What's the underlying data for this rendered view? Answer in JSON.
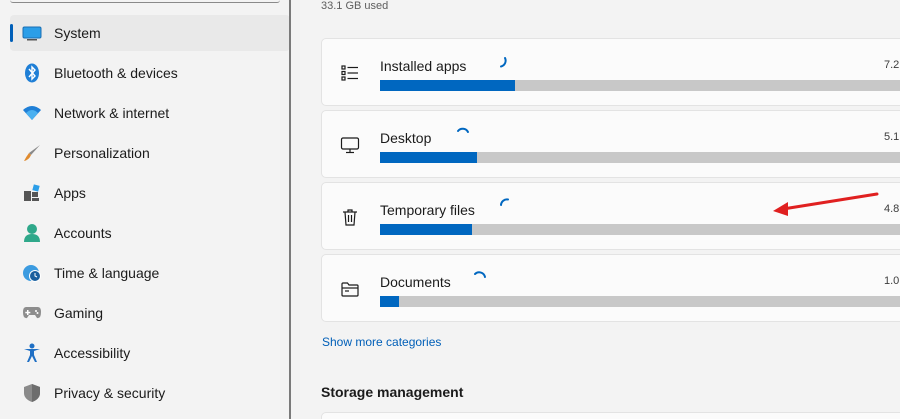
{
  "sidebar": {
    "items": [
      {
        "label": "System",
        "icon": "monitor-icon",
        "selected": true
      },
      {
        "label": "Bluetooth & devices",
        "icon": "bluetooth-icon"
      },
      {
        "label": "Network & internet",
        "icon": "wifi-icon"
      },
      {
        "label": "Personalization",
        "icon": "paintbrush-icon"
      },
      {
        "label": "Apps",
        "icon": "apps-grid-icon"
      },
      {
        "label": "Accounts",
        "icon": "person-icon"
      },
      {
        "label": "Time & language",
        "icon": "globe-clock-icon"
      },
      {
        "label": "Gaming",
        "icon": "gamepad-icon"
      },
      {
        "label": "Accessibility",
        "icon": "accessibility-icon"
      },
      {
        "label": "Privacy & security",
        "icon": "shield-icon"
      }
    ]
  },
  "storage": {
    "used_text": "33.1 GB used",
    "categories": [
      {
        "name": "Installed apps",
        "size": "7.2",
        "icon": "list-icon",
        "fill_percent": 25
      },
      {
        "name": "Desktop",
        "size": "5.1",
        "icon": "desktop-icon",
        "fill_percent": 18
      },
      {
        "name": "Temporary files",
        "size": "4.8",
        "icon": "trash-icon",
        "fill_percent": 17
      },
      {
        "name": "Documents",
        "size": "1.0",
        "icon": "folder-icon",
        "fill_percent": 3.5
      }
    ],
    "show_more_label": "Show more categories",
    "management_title": "Storage management"
  },
  "colors": {
    "accent": "#0067c0",
    "track": "#c8c8c8",
    "arrow": "#e02020"
  }
}
